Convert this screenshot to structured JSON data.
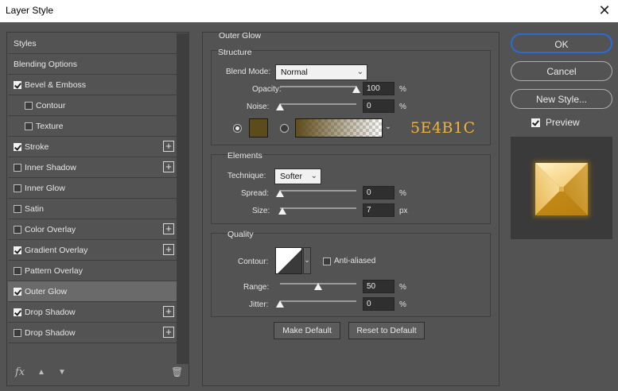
{
  "window": {
    "title": "Layer Style",
    "close_glyph": "✕"
  },
  "styles_list": {
    "items": [
      {
        "label": "Styles",
        "checkbox": null,
        "plus": false,
        "indent": 0
      },
      {
        "label": "Blending Options",
        "checkbox": null,
        "plus": false,
        "indent": 0
      },
      {
        "label": "Bevel & Emboss",
        "checkbox": true,
        "plus": false,
        "indent": 0
      },
      {
        "label": "Contour",
        "checkbox": false,
        "plus": false,
        "indent": 1
      },
      {
        "label": "Texture",
        "checkbox": false,
        "plus": false,
        "indent": 1
      },
      {
        "label": "Stroke",
        "checkbox": true,
        "plus": true,
        "indent": 0
      },
      {
        "label": "Inner Shadow",
        "checkbox": false,
        "plus": true,
        "indent": 0
      },
      {
        "label": "Inner Glow",
        "checkbox": false,
        "plus": false,
        "indent": 0
      },
      {
        "label": "Satin",
        "checkbox": false,
        "plus": false,
        "indent": 0
      },
      {
        "label": "Color Overlay",
        "checkbox": false,
        "plus": true,
        "indent": 0
      },
      {
        "label": "Gradient Overlay",
        "checkbox": true,
        "plus": true,
        "indent": 0
      },
      {
        "label": "Pattern Overlay",
        "checkbox": false,
        "plus": false,
        "indent": 0
      },
      {
        "label": "Outer Glow",
        "checkbox": true,
        "plus": false,
        "indent": 0,
        "selected": true
      },
      {
        "label": "Drop Shadow",
        "checkbox": true,
        "plus": true,
        "indent": 0
      },
      {
        "label": "Drop Shadow",
        "checkbox": false,
        "plus": true,
        "indent": 0
      }
    ],
    "bottom_icons": {
      "fx": "fx",
      "up": "▲",
      "down": "▼",
      "trash": "🗑"
    }
  },
  "outer_glow": {
    "heading": "Outer Glow",
    "structure": {
      "heading": "Structure",
      "blend_mode_label": "Blend Mode:",
      "blend_mode_value": "Normal",
      "opacity_label": "Opacity:",
      "opacity_value": "100",
      "opacity_unit": "%",
      "noise_label": "Noise:",
      "noise_value": "0",
      "noise_unit": "%",
      "color_hex": "#5E4B1C",
      "color_annotation": "5E4B1C"
    },
    "elements": {
      "heading": "Elements",
      "technique_label": "Technique:",
      "technique_value": "Softer",
      "spread_label": "Spread:",
      "spread_value": "0",
      "spread_unit": "%",
      "size_label": "Size:",
      "size_value": "7",
      "size_unit": "px"
    },
    "quality": {
      "heading": "Quality",
      "contour_label": "Contour:",
      "anti_aliased_label": "Anti-aliased",
      "anti_aliased_checked": false,
      "range_label": "Range:",
      "range_value": "50",
      "range_unit": "%",
      "jitter_label": "Jitter:",
      "jitter_value": "0",
      "jitter_unit": "%"
    },
    "make_default_label": "Make Default",
    "reset_default_label": "Reset to Default"
  },
  "actions": {
    "ok_label": "OK",
    "cancel_label": "Cancel",
    "new_style_label": "New Style...",
    "preview_label": "Preview",
    "preview_checked": true
  },
  "colors": {
    "accent": "#2b6bd6",
    "glow": "#5E4B1C",
    "annotation": "#f2b33a"
  }
}
